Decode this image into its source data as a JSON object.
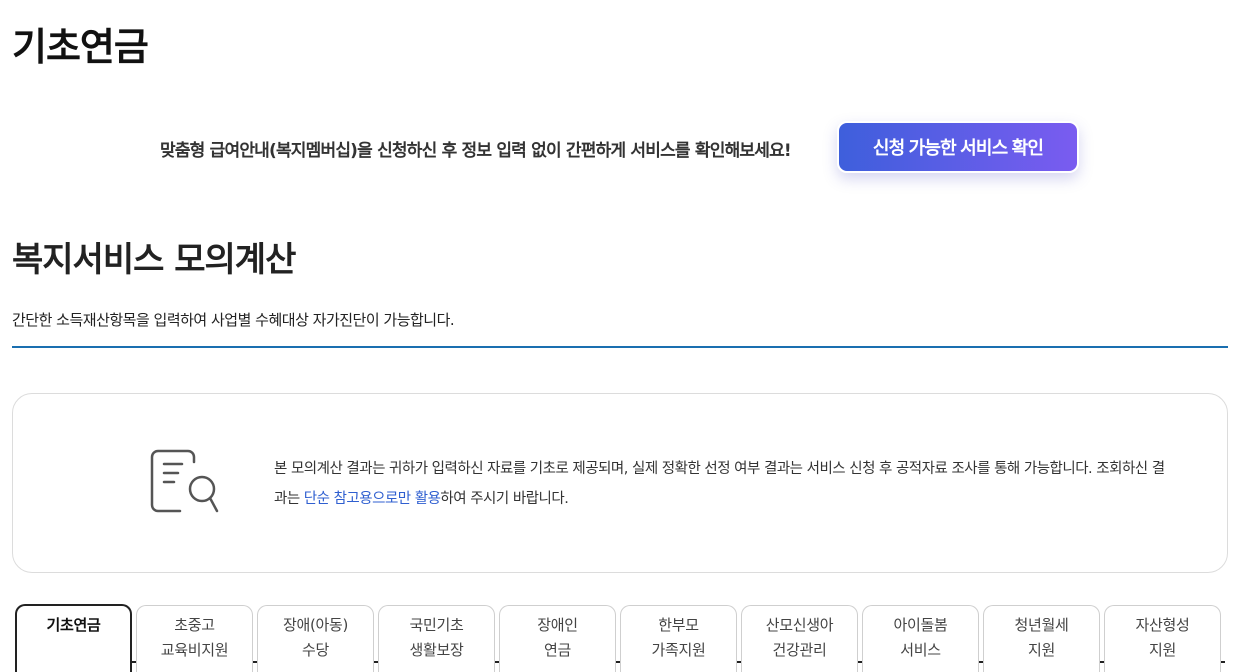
{
  "page": {
    "title": "기초연금"
  },
  "promo": {
    "text": "맞춤형 급여안내(복지멤버십)을 신청하신 후 정보 입력 없이 간편하게 서비스를 확인해보세요!",
    "button_label": "신청 가능한 서비스 확인"
  },
  "section": {
    "title": "복지서비스 모의계산",
    "description": "간단한 소득재산항목을 입력하여 사업별 수혜대상 자가진단이 가능합니다."
  },
  "notice": {
    "icon": "document-search-icon",
    "text_before": "본 모의계산 결과는 귀하가 입력하신 자료를 기초로 제공되며, 실제 정확한 선정 여부 결과는 서비스 신청 후 공적자료 조사를 통해 가능합니다. 조회하신 결과는 ",
    "text_highlight": "단순 참고용으로만 활용",
    "text_after": "하여 주시기 바랍니다."
  },
  "tabs": [
    {
      "line1": "기초연금",
      "line2": ""
    },
    {
      "line1": "초중고",
      "line2": "교육비지원"
    },
    {
      "line1": "장애(아동)",
      "line2": "수당"
    },
    {
      "line1": "국민기초",
      "line2": "생활보장"
    },
    {
      "line1": "장애인",
      "line2": "연금"
    },
    {
      "line1": "한부모",
      "line2": "가족지원"
    },
    {
      "line1": "산모신생아",
      "line2": "건강관리"
    },
    {
      "line1": "아이돌봄",
      "line2": "서비스"
    },
    {
      "line1": "청년월세",
      "line2": "지원"
    },
    {
      "line1": "자산형성",
      "line2": "지원"
    }
  ],
  "colors": {
    "accent_rule": "#1a6fb0",
    "button_start": "#3e5fdc",
    "button_end": "#7a5cf0",
    "highlight_text": "#2f5fd0"
  }
}
